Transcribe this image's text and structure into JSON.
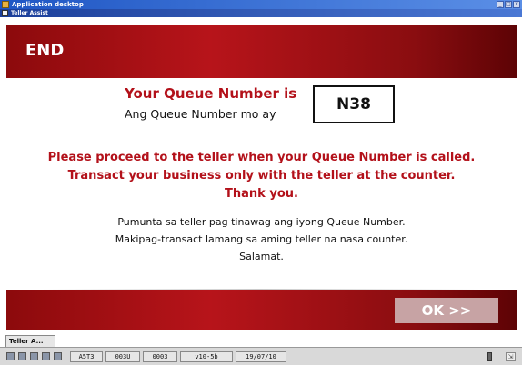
{
  "app_window": {
    "title": "Application desktop",
    "controls": [
      "_",
      "□",
      "x"
    ]
  },
  "inner_window": {
    "title": "Teller Assist"
  },
  "header": {
    "title": "END"
  },
  "queue": {
    "label_en": "Your Queue Number is",
    "label_tl": "Ang Queue Number mo ay",
    "number": "N38"
  },
  "message_en": {
    "line1": "Please proceed to the teller when your Queue Number is called.",
    "line2": "Transact your business only with the teller at the counter.",
    "line3": "Thank you."
  },
  "message_tl": {
    "line1": "Pumunta sa teller pag tinawag ang iyong Queue Number.",
    "line2": "Makipag-transact lamang sa aming teller na nasa counter.",
    "line3": "Salamat."
  },
  "footer": {
    "ok_label": "OK >>"
  },
  "taskbar": {
    "tab_label": "Teller A..."
  },
  "statusbar": {
    "cells": [
      "A5T3",
      "003U",
      "0003",
      "v10-5b",
      "19/07/10"
    ]
  },
  "colors": {
    "brand_red": "#b3111a",
    "band_dark": "#8c0a0c",
    "ok_disabled": "#c7a3a4"
  }
}
